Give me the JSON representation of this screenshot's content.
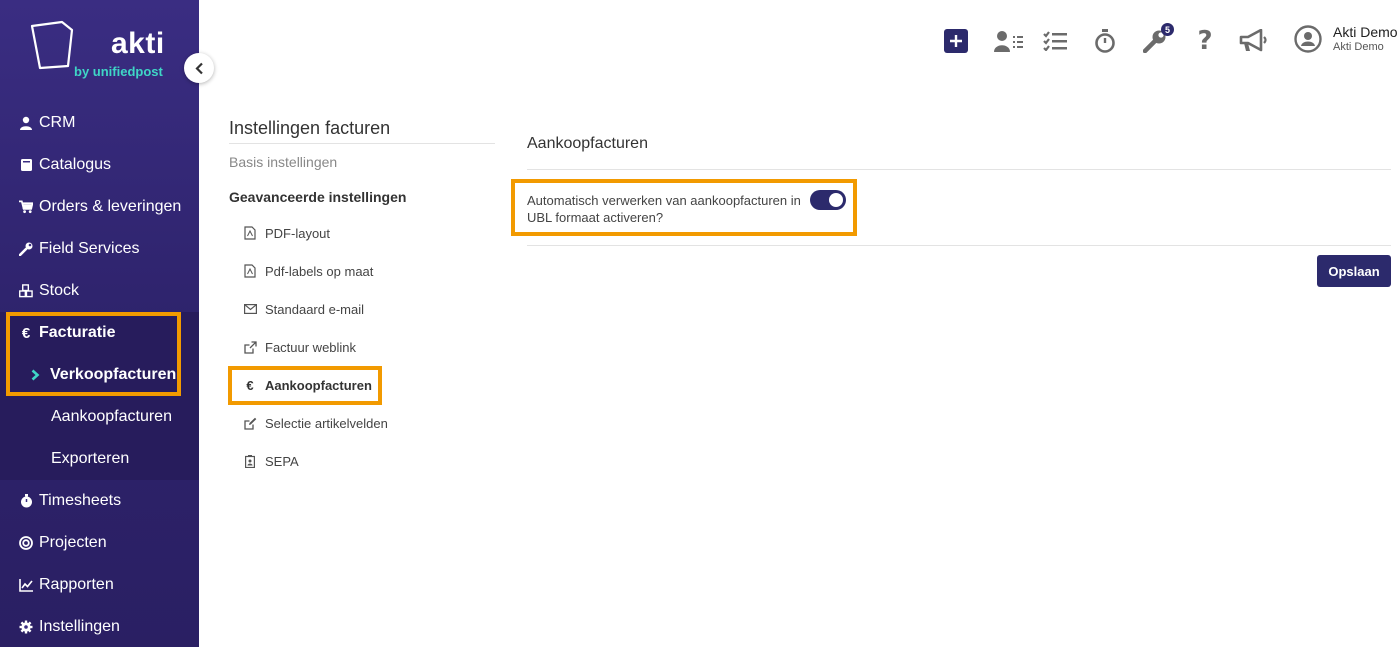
{
  "brand": {
    "name": "akti",
    "tagline": "by unifiedpost"
  },
  "sidebar": {
    "items": [
      {
        "label": "CRM",
        "icon": "user-icon"
      },
      {
        "label": "Catalogus",
        "icon": "book-icon"
      },
      {
        "label": "Orders & leveringen",
        "icon": "cart-icon"
      },
      {
        "label": "Field Services",
        "icon": "wrench-icon"
      },
      {
        "label": "Stock",
        "icon": "cubes-icon"
      },
      {
        "label": "Facturatie",
        "icon": "euro-icon"
      },
      {
        "label": "Timesheets",
        "icon": "stopwatch-icon"
      },
      {
        "label": "Projecten",
        "icon": "target-icon"
      },
      {
        "label": "Rapporten",
        "icon": "chart-icon"
      },
      {
        "label": "Instellingen",
        "icon": "gear-icon"
      }
    ],
    "subitems": [
      {
        "label": "Verkoopfacturen"
      },
      {
        "label": "Aankoopfacturen"
      },
      {
        "label": "Exporteren"
      }
    ]
  },
  "topbar": {
    "notification_count": "5",
    "user_name": "Akti Demo",
    "user_company": "Akti Demo"
  },
  "settings_menu": {
    "title": "Instellingen facturen",
    "basic": "Basis instellingen",
    "advanced": "Geavanceerde instellingen",
    "items": [
      {
        "label": "PDF-layout",
        "icon": "pdf-file-icon"
      },
      {
        "label": "Pdf-labels op maat",
        "icon": "pdf-file-icon"
      },
      {
        "label": "Standaard e-mail",
        "icon": "envelope-icon"
      },
      {
        "label": "Factuur weblink",
        "icon": "external-link-icon"
      },
      {
        "label": "Aankoopfacturen",
        "icon": "euro-icon"
      },
      {
        "label": "Selectie artikelvelden",
        "icon": "edit-icon"
      },
      {
        "label": "SEPA",
        "icon": "id-badge-icon"
      }
    ]
  },
  "main": {
    "section_title": "Aankoopfacturen",
    "setting_label": "Automatisch verwerken van aankoopfacturen in UBL formaat activeren?",
    "toggle_on": true,
    "save_label": "Opslaan"
  },
  "colors": {
    "primary": "#2c2a6c",
    "sidebar": "#3a2d82",
    "highlight": "#f29a00",
    "brand_accent": "#3fd6c6"
  }
}
